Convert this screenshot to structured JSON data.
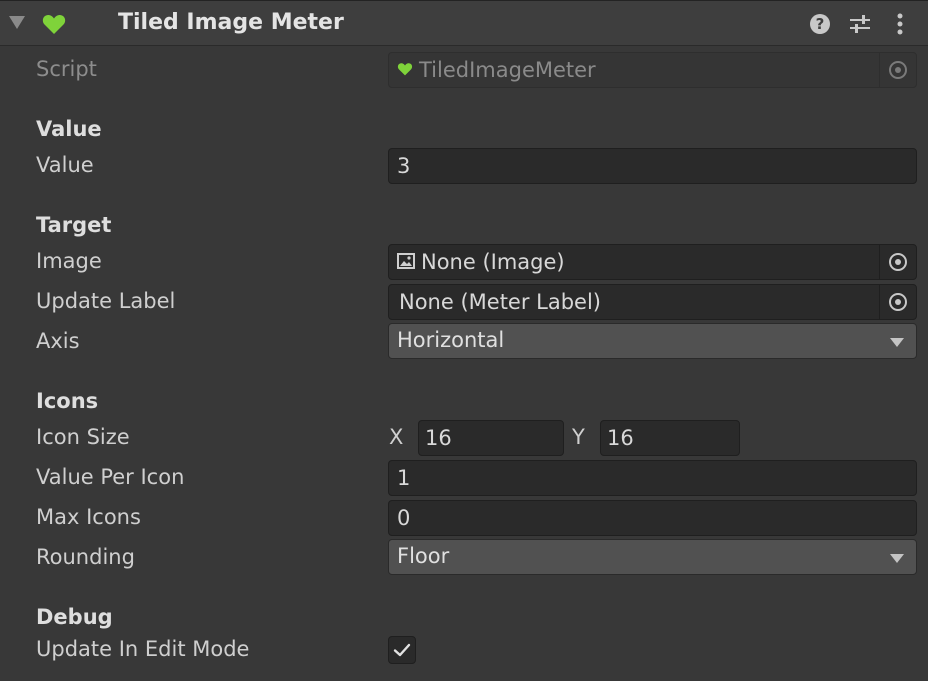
{
  "component": {
    "title": "Tiled Image Meter",
    "icons": {
      "foldout": "foldout-triangle",
      "component": "heart-icon",
      "help": "help-icon",
      "presets": "presets-sliders-icon",
      "menu": "kebab-menu-icon"
    },
    "heart_color": "#7fd33a"
  },
  "script": {
    "label": "Script",
    "value": "TiledImageMeter"
  },
  "sections": {
    "value": "Value",
    "target": "Target",
    "icons": "Icons",
    "debug": "Debug"
  },
  "fields": {
    "value": {
      "label": "Value",
      "value": "3"
    },
    "image": {
      "label": "Image",
      "value": "None (Image)"
    },
    "update_label": {
      "label": "Update Label",
      "value": "None (Meter Label)"
    },
    "axis": {
      "label": "Axis",
      "value": "Horizontal"
    },
    "icon_size": {
      "label": "Icon Size",
      "x_label": "X",
      "x": "16",
      "y_label": "Y",
      "y": "16"
    },
    "value_per_icon": {
      "label": "Value Per Icon",
      "value": "1"
    },
    "max_icons": {
      "label": "Max Icons",
      "value": "0"
    },
    "rounding": {
      "label": "Rounding",
      "value": "Floor"
    },
    "update_in_edit_mode": {
      "label": "Update In Edit Mode",
      "checked": true
    }
  }
}
